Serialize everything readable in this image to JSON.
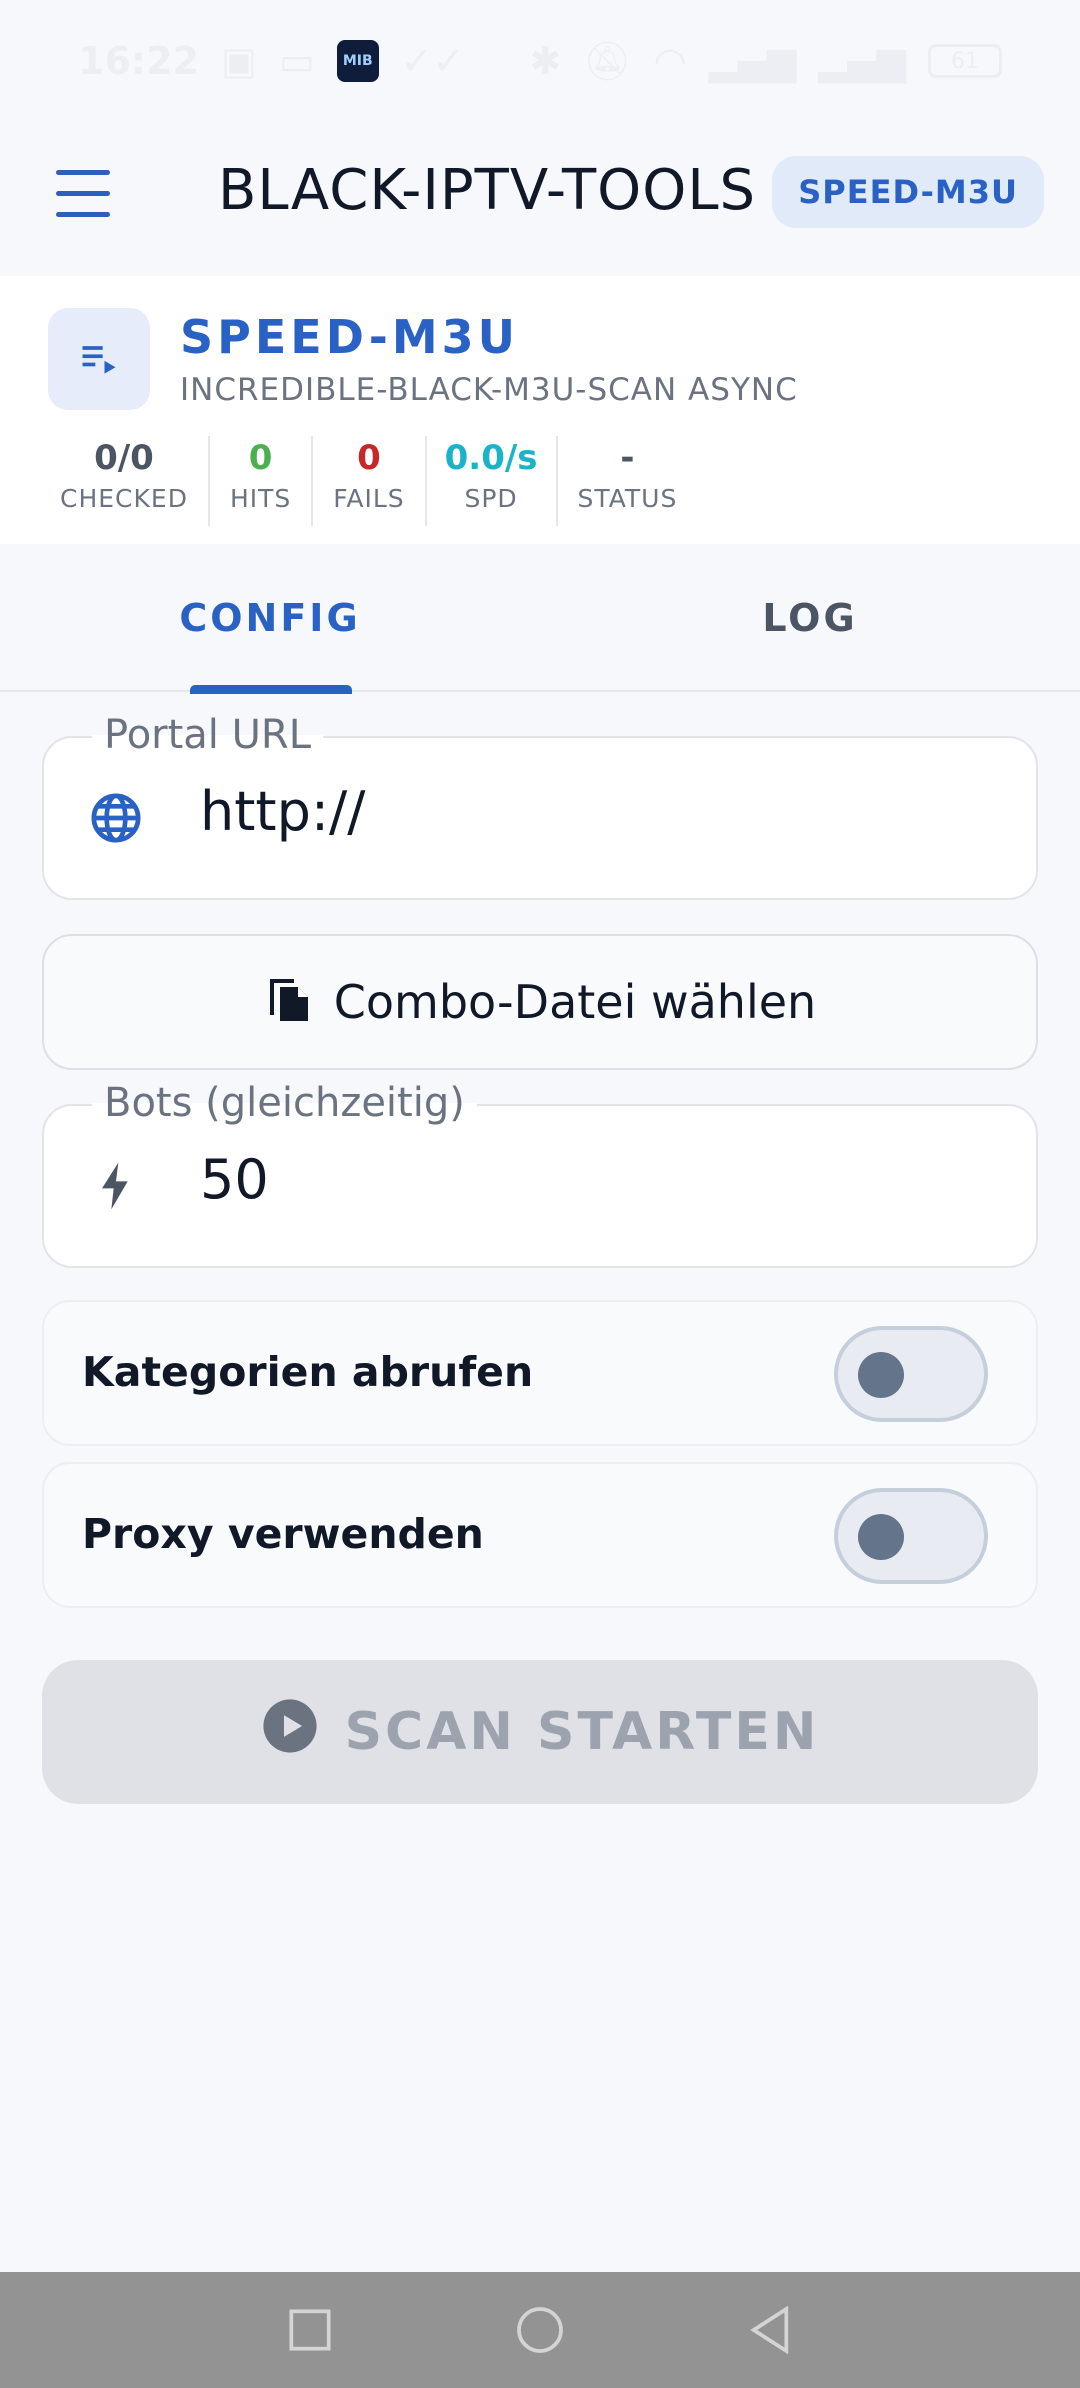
{
  "status_bar": {
    "time": "16:22",
    "app_badge": "MIB",
    "battery": "61"
  },
  "app_bar": {
    "title": "BLACK-IPTV-TOOLS",
    "mode_chip": "SPEED-M3U"
  },
  "header": {
    "title": "SPEED-M3U",
    "subtitle": "INCREDIBLE-BLACK-M3U-SCAN ASYNC",
    "stats": [
      {
        "value": "0/0",
        "label": "CHECKED",
        "color": "#4b5563"
      },
      {
        "value": "0",
        "label": "HITS",
        "color": "#4caf50"
      },
      {
        "value": "0",
        "label": "FAILS",
        "color": "#c62828"
      },
      {
        "value": "0.0/s",
        "label": "SPD",
        "color": "#1bb3c8"
      },
      {
        "value": "-",
        "label": "STATUS",
        "color": "#4b5563"
      }
    ]
  },
  "tabs": [
    {
      "label": "CONFIG",
      "active": true
    },
    {
      "label": "LOG",
      "active": false
    }
  ],
  "config": {
    "portal_url": {
      "label": "Portal URL",
      "value": "http://",
      "icon": "globe-icon"
    },
    "combo_button": {
      "label": "Combo-Datei wählen",
      "icon": "file-copy-icon"
    },
    "bots": {
      "label": "Bots (gleichzeitig)",
      "value": "50",
      "icon": "bolt-icon"
    },
    "toggles": [
      {
        "label": "Kategorien abrufen",
        "on": false
      },
      {
        "label": "Proxy verwenden",
        "on": false
      }
    ],
    "scan_button": {
      "label": "SCAN STARTEN",
      "icon": "play-circle-icon",
      "enabled": false
    }
  },
  "colors": {
    "accent": "#2962c4",
    "background": "#f7f8fb"
  }
}
